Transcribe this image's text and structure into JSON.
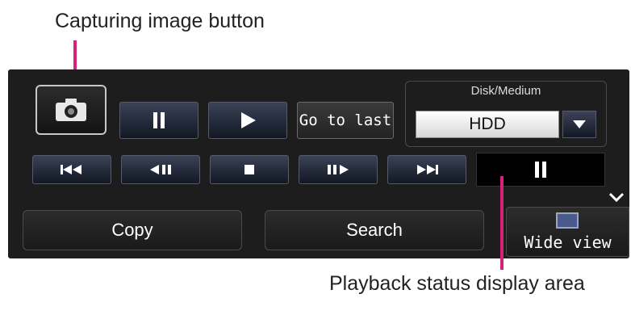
{
  "callouts": {
    "capture_label": "Capturing image button",
    "status_label": "Playback status display area"
  },
  "panel": {
    "goto_last_label": "Go to last",
    "disk": {
      "title": "Disk/Medium",
      "selected": "HDD"
    },
    "copy_label": "Copy",
    "search_label": "Search",
    "wide_view_label": "Wide view",
    "status_display": "pause-icon"
  },
  "colors": {
    "callout_line": "#d6237a",
    "panel_bg": "#1d1d1d",
    "button_blue": "#232a3a",
    "wide_view_icon": "#4a5a8a"
  }
}
